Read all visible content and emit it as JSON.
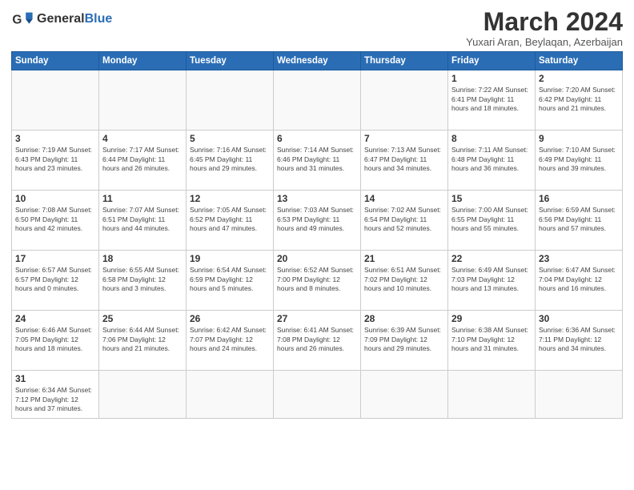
{
  "header": {
    "logo_text_general": "General",
    "logo_text_blue": "Blue",
    "main_title": "March 2024",
    "subtitle": "Yuxari Aran, Beylaqan, Azerbaijan"
  },
  "weekdays": [
    "Sunday",
    "Monday",
    "Tuesday",
    "Wednesday",
    "Thursday",
    "Friday",
    "Saturday"
  ],
  "weeks": [
    [
      {
        "day": "",
        "info": ""
      },
      {
        "day": "",
        "info": ""
      },
      {
        "day": "",
        "info": ""
      },
      {
        "day": "",
        "info": ""
      },
      {
        "day": "",
        "info": ""
      },
      {
        "day": "1",
        "info": "Sunrise: 7:22 AM\nSunset: 6:41 PM\nDaylight: 11 hours\nand 18 minutes."
      },
      {
        "day": "2",
        "info": "Sunrise: 7:20 AM\nSunset: 6:42 PM\nDaylight: 11 hours\nand 21 minutes."
      }
    ],
    [
      {
        "day": "3",
        "info": "Sunrise: 7:19 AM\nSunset: 6:43 PM\nDaylight: 11 hours\nand 23 minutes."
      },
      {
        "day": "4",
        "info": "Sunrise: 7:17 AM\nSunset: 6:44 PM\nDaylight: 11 hours\nand 26 minutes."
      },
      {
        "day": "5",
        "info": "Sunrise: 7:16 AM\nSunset: 6:45 PM\nDaylight: 11 hours\nand 29 minutes."
      },
      {
        "day": "6",
        "info": "Sunrise: 7:14 AM\nSunset: 6:46 PM\nDaylight: 11 hours\nand 31 minutes."
      },
      {
        "day": "7",
        "info": "Sunrise: 7:13 AM\nSunset: 6:47 PM\nDaylight: 11 hours\nand 34 minutes."
      },
      {
        "day": "8",
        "info": "Sunrise: 7:11 AM\nSunset: 6:48 PM\nDaylight: 11 hours\nand 36 minutes."
      },
      {
        "day": "9",
        "info": "Sunrise: 7:10 AM\nSunset: 6:49 PM\nDaylight: 11 hours\nand 39 minutes."
      }
    ],
    [
      {
        "day": "10",
        "info": "Sunrise: 7:08 AM\nSunset: 6:50 PM\nDaylight: 11 hours\nand 42 minutes."
      },
      {
        "day": "11",
        "info": "Sunrise: 7:07 AM\nSunset: 6:51 PM\nDaylight: 11 hours\nand 44 minutes."
      },
      {
        "day": "12",
        "info": "Sunrise: 7:05 AM\nSunset: 6:52 PM\nDaylight: 11 hours\nand 47 minutes."
      },
      {
        "day": "13",
        "info": "Sunrise: 7:03 AM\nSunset: 6:53 PM\nDaylight: 11 hours\nand 49 minutes."
      },
      {
        "day": "14",
        "info": "Sunrise: 7:02 AM\nSunset: 6:54 PM\nDaylight: 11 hours\nand 52 minutes."
      },
      {
        "day": "15",
        "info": "Sunrise: 7:00 AM\nSunset: 6:55 PM\nDaylight: 11 hours\nand 55 minutes."
      },
      {
        "day": "16",
        "info": "Sunrise: 6:59 AM\nSunset: 6:56 PM\nDaylight: 11 hours\nand 57 minutes."
      }
    ],
    [
      {
        "day": "17",
        "info": "Sunrise: 6:57 AM\nSunset: 6:57 PM\nDaylight: 12 hours\nand 0 minutes."
      },
      {
        "day": "18",
        "info": "Sunrise: 6:55 AM\nSunset: 6:58 PM\nDaylight: 12 hours\nand 3 minutes."
      },
      {
        "day": "19",
        "info": "Sunrise: 6:54 AM\nSunset: 6:59 PM\nDaylight: 12 hours\nand 5 minutes."
      },
      {
        "day": "20",
        "info": "Sunrise: 6:52 AM\nSunset: 7:00 PM\nDaylight: 12 hours\nand 8 minutes."
      },
      {
        "day": "21",
        "info": "Sunrise: 6:51 AM\nSunset: 7:02 PM\nDaylight: 12 hours\nand 10 minutes."
      },
      {
        "day": "22",
        "info": "Sunrise: 6:49 AM\nSunset: 7:03 PM\nDaylight: 12 hours\nand 13 minutes."
      },
      {
        "day": "23",
        "info": "Sunrise: 6:47 AM\nSunset: 7:04 PM\nDaylight: 12 hours\nand 16 minutes."
      }
    ],
    [
      {
        "day": "24",
        "info": "Sunrise: 6:46 AM\nSunset: 7:05 PM\nDaylight: 12 hours\nand 18 minutes."
      },
      {
        "day": "25",
        "info": "Sunrise: 6:44 AM\nSunset: 7:06 PM\nDaylight: 12 hours\nand 21 minutes."
      },
      {
        "day": "26",
        "info": "Sunrise: 6:42 AM\nSunset: 7:07 PM\nDaylight: 12 hours\nand 24 minutes."
      },
      {
        "day": "27",
        "info": "Sunrise: 6:41 AM\nSunset: 7:08 PM\nDaylight: 12 hours\nand 26 minutes."
      },
      {
        "day": "28",
        "info": "Sunrise: 6:39 AM\nSunset: 7:09 PM\nDaylight: 12 hours\nand 29 minutes."
      },
      {
        "day": "29",
        "info": "Sunrise: 6:38 AM\nSunset: 7:10 PM\nDaylight: 12 hours\nand 31 minutes."
      },
      {
        "day": "30",
        "info": "Sunrise: 6:36 AM\nSunset: 7:11 PM\nDaylight: 12 hours\nand 34 minutes."
      }
    ],
    [
      {
        "day": "31",
        "info": "Sunrise: 6:34 AM\nSunset: 7:12 PM\nDaylight: 12 hours\nand 37 minutes."
      },
      {
        "day": "",
        "info": ""
      },
      {
        "day": "",
        "info": ""
      },
      {
        "day": "",
        "info": ""
      },
      {
        "day": "",
        "info": ""
      },
      {
        "day": "",
        "info": ""
      },
      {
        "day": "",
        "info": ""
      }
    ]
  ]
}
